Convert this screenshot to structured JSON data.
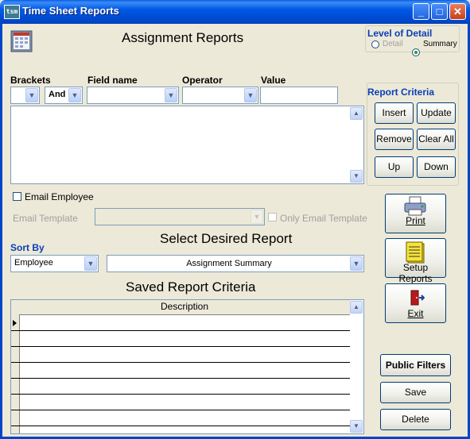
{
  "window": {
    "title": "Time Sheet Reports",
    "icon_text": "tsm"
  },
  "header": {
    "title": "Assignment Reports"
  },
  "level_of_detail": {
    "label": "Level of Detail",
    "options": [
      "Detail",
      "Summary"
    ],
    "selected": "Summary"
  },
  "criteria": {
    "brackets_label": "Brackets",
    "field_name_label": "Field name",
    "operator_label": "Operator",
    "value_label": "Value",
    "conjunction_value": "And"
  },
  "report_criteria": {
    "label": "Report Criteria",
    "buttons": {
      "insert": "Insert",
      "update": "Update",
      "remove": "Remove",
      "clear_all": "Clear All",
      "up": "Up",
      "down": "Down"
    }
  },
  "email": {
    "employee_label": "Email Employee",
    "template_label": "Email Template",
    "only_template_label": "Only Email Template"
  },
  "actions": {
    "print": "Print",
    "setup_reports": "Setup Reports",
    "exit": "Exit",
    "public_filters": "Public Filters",
    "save": "Save",
    "delete": "Delete"
  },
  "sort": {
    "label": "Sort By",
    "value": "Employee"
  },
  "report_select": {
    "title": "Select Desired Report",
    "value": "Assignment Summary"
  },
  "saved": {
    "title": "Saved Report Criteria",
    "column": "Description"
  }
}
